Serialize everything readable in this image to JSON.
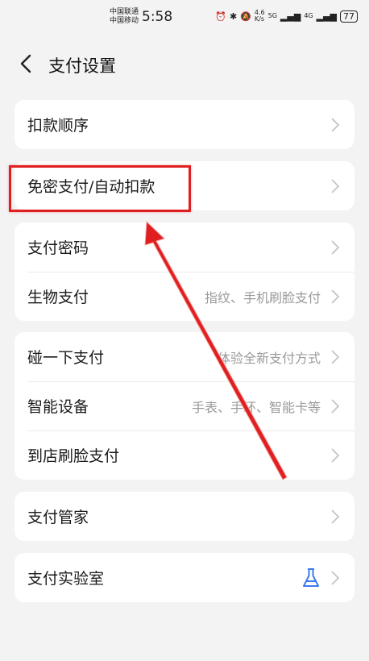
{
  "status_bar": {
    "carrier_1": "中国联通",
    "carrier_2": "中国移动",
    "time": "5:58",
    "net_speed_value": "4.6",
    "net_speed_unit": "K/s",
    "signal_1": "5G",
    "signal_2": "4G",
    "battery": "77"
  },
  "header": {
    "title": "支付设置"
  },
  "groups": [
    {
      "rows": [
        {
          "label": "扣款顺序",
          "value": ""
        }
      ]
    },
    {
      "rows": [
        {
          "label": "免密支付/自动扣款",
          "value": ""
        }
      ]
    },
    {
      "rows": [
        {
          "label": "支付密码",
          "value": ""
        },
        {
          "label": "生物支付",
          "value": "指纹、手机刷脸支付"
        }
      ]
    },
    {
      "rows": [
        {
          "label": "碰一下支付",
          "value": "体验全新支付方式"
        },
        {
          "label": "智能设备",
          "value": "手表、手环、智能卡等"
        },
        {
          "label": "到店刷脸支付",
          "value": ""
        }
      ]
    },
    {
      "rows": [
        {
          "label": "支付管家",
          "value": ""
        }
      ]
    },
    {
      "rows": [
        {
          "label": "支付实验室",
          "value": ""
        }
      ]
    }
  ],
  "icons": [
    "alarm-icon",
    "bluetooth-icon",
    "mute-icon",
    "signal-icon",
    "battery-icon",
    "back-arrow-icon",
    "chevron-right-icon",
    "flask-icon"
  ],
  "colors": {
    "highlight": "#e02020",
    "accent_blue": "#3a7bf0",
    "background": "#f3f3f3"
  }
}
